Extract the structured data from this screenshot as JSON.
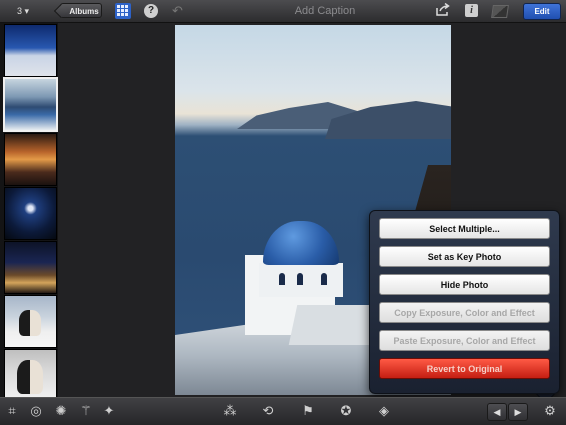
{
  "topbar": {
    "photo_count": "3 ▾",
    "albums_label": "Albums",
    "help_label": "?",
    "caption_placeholder": "Add Caption",
    "info_label": "i",
    "edit_label": "Edit"
  },
  "icons": {
    "grid": "grid-icon",
    "undo": "undo-icon",
    "share": "share-icon",
    "compare": "compare-icon",
    "crop": "crop-icon",
    "exposure": "exposure-icon",
    "color": "palette-icon",
    "brushes": "brushes-icon",
    "effects": "effects-icon",
    "auto_enhance": "magic-wand-icon",
    "rotate": "rotate-icon",
    "flag": "flag-icon",
    "favorite": "rosette-icon",
    "hide": "tag-icon",
    "prev": "arrow-left-icon",
    "next": "arrow-right-icon",
    "gear": "gear-icon"
  },
  "menu": {
    "items": [
      {
        "label": "Select Multiple...",
        "state": "enabled"
      },
      {
        "label": "Set as Key Photo",
        "state": "enabled"
      },
      {
        "label": "Hide Photo",
        "state": "enabled"
      },
      {
        "label": "Copy Exposure, Color and Effect",
        "state": "disabled"
      },
      {
        "label": "Paste Exposure, Color and Effect",
        "state": "disabled"
      },
      {
        "label": "Revert to Original",
        "state": "destructive"
      }
    ]
  },
  "colors": {
    "accent": "#2d62c8",
    "destructive": "#d9271a",
    "toolbar": "#2c2c2e"
  }
}
